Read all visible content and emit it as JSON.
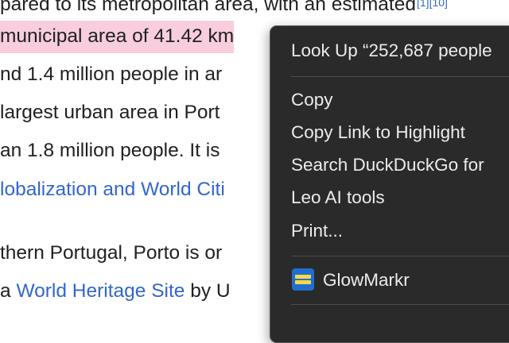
{
  "article": {
    "line0": "pared to its metropolitan area, with an estimated",
    "line0_cite": "[1][10]",
    "line1": "municipal area of 41.42 km",
    "line2": "nd 1.4 million people in ar",
    "line3": "largest urban area in Port",
    "line4": "an 1.8 million people. It is",
    "line5_link": "lobalization and World Citi",
    "line6": "thern Portugal, Porto is or",
    "line7_prefix": "a ",
    "line7_link": "World Heritage Site",
    "line7_suffix": " by U"
  },
  "context_menu": {
    "look_up": "Look Up “252,687 people",
    "copy": "Copy",
    "copy_link_highlight": "Copy Link to Highlight",
    "search": "Search DuckDuckGo for",
    "leo": "Leo AI tools",
    "print": "Print...",
    "glowmarkr": "GlowMarkr",
    "glowmarkr_icon": "glowmarkr-icon"
  },
  "colors": {
    "highlight": "#f8cddd",
    "link": "#3366cc",
    "menu_bg": "#2a2a2a",
    "menu_text": "#ececec"
  }
}
